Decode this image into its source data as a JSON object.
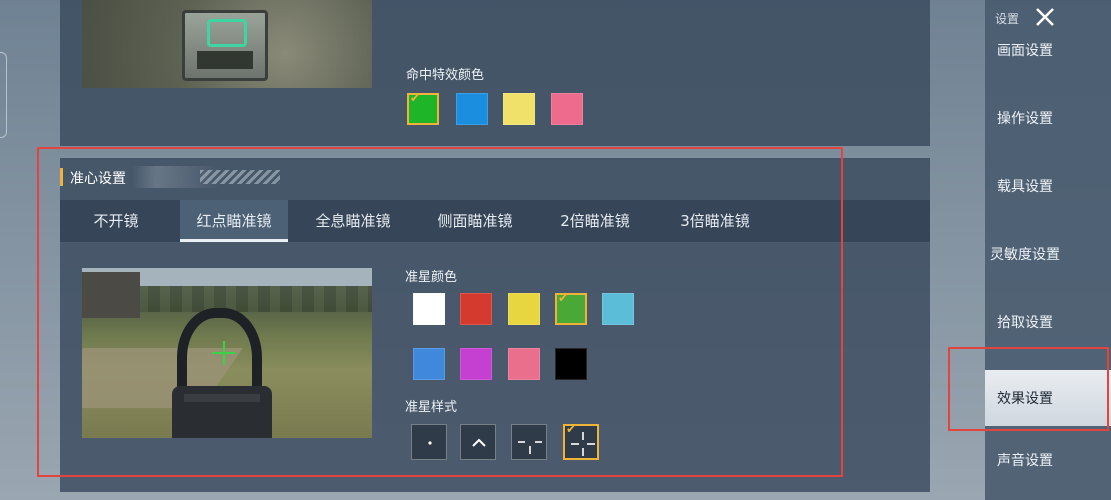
{
  "sidebar": {
    "header": "设置",
    "items": [
      {
        "label": "画面设置"
      },
      {
        "label": "操作设置"
      },
      {
        "label": "载具设置"
      },
      {
        "label": "灵敏度设置"
      },
      {
        "label": "拾取设置"
      },
      {
        "label": "效果设置",
        "active": true
      },
      {
        "label": "声音设置"
      }
    ]
  },
  "hit_effect": {
    "label": "命中特效颜色",
    "colors": [
      "#1fb529",
      "#1c8ee0",
      "#efe16a",
      "#ee6b8d"
    ],
    "selected_index": 0
  },
  "crosshair_section": {
    "title": "准心设置",
    "tabs": [
      {
        "label": "不开镜"
      },
      {
        "label": "红点瞄准镜",
        "active": true
      },
      {
        "label": "全息瞄准镜"
      },
      {
        "label": "侧面瞄准镜"
      },
      {
        "label": "2倍瞄准镜"
      },
      {
        "label": "3倍瞄准镜"
      }
    ],
    "color_label": "准星颜色",
    "colors": [
      "#ffffff",
      "#d43a2e",
      "#e8d640",
      "#4aa837",
      "#5bbdd8",
      "#3f88dc",
      "#c53fd0",
      "#ea6f8c",
      "#000000"
    ],
    "selected_color_index": 3,
    "style_label": "准星样式",
    "styles": [
      "dot-icon",
      "chevron-icon",
      "dashed-crosshair-icon",
      "crosshair-icon"
    ],
    "selected_style_index": 3
  },
  "colors": {
    "accent": "#f0b33a",
    "highlight_box": "#e2453f",
    "reticle": "#3bd24a"
  }
}
